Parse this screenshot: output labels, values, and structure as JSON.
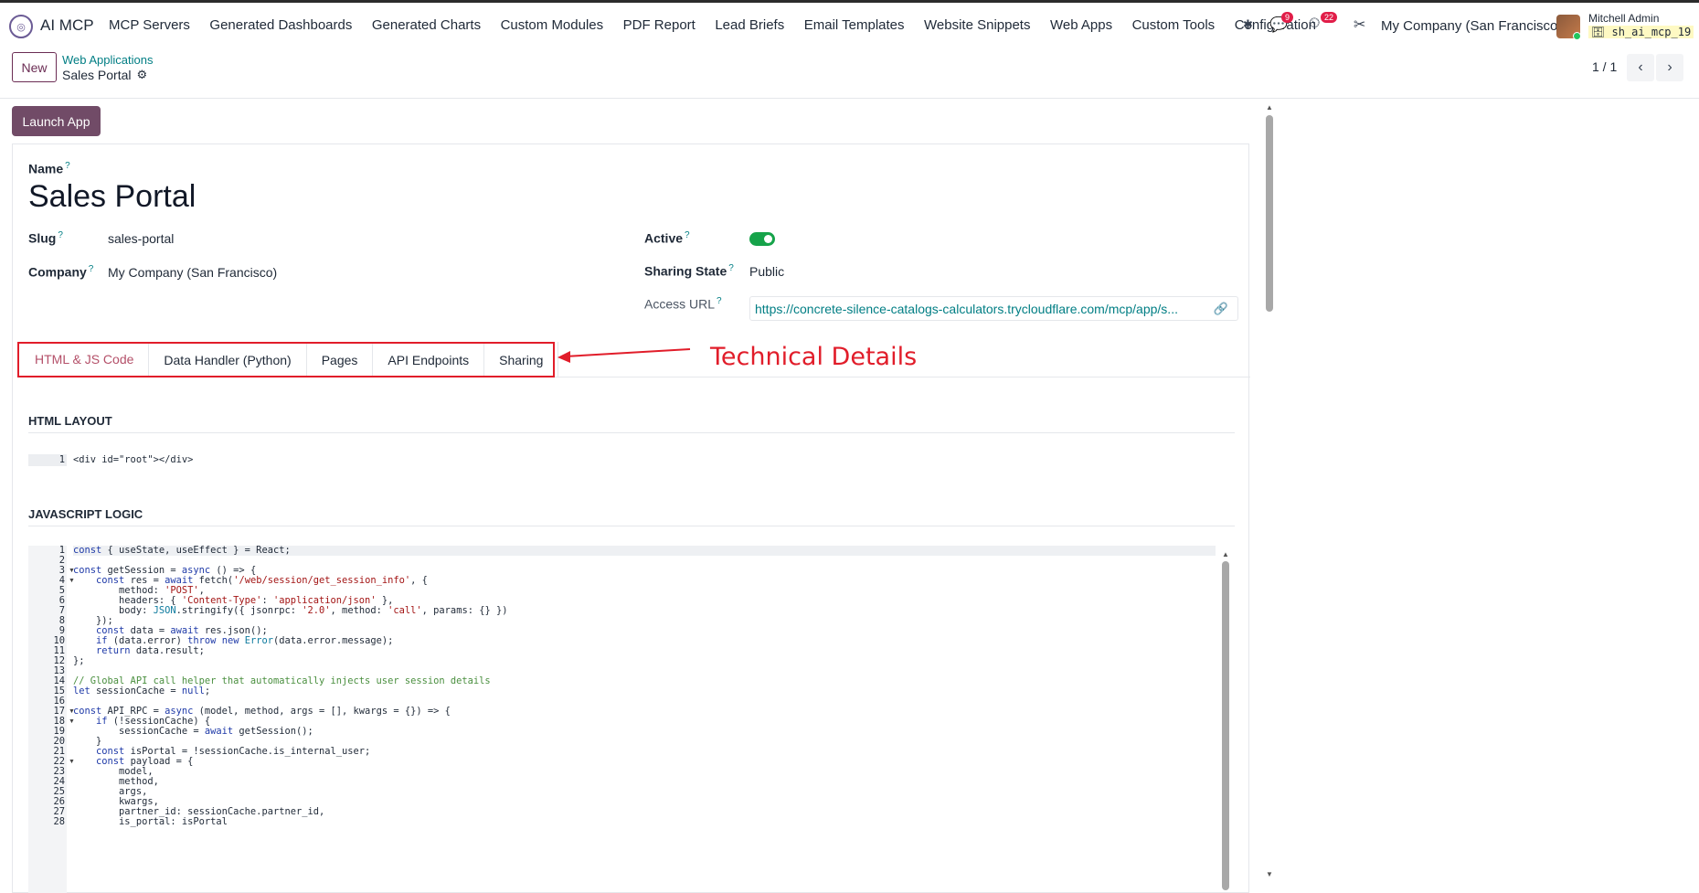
{
  "topbar": {
    "app_name": "AI MCP",
    "menu": [
      "MCP Servers",
      "Generated Dashboards",
      "Generated Charts",
      "Custom Modules",
      "PDF Report",
      "Lead Briefs",
      "Email Templates",
      "Website Snippets",
      "Web Apps",
      "Custom Tools",
      "Configuration"
    ],
    "messages_badge": "9",
    "activity_badge": "22",
    "company": "My Company (San Francisco)",
    "user_name": "Mitchell Admin",
    "database": "sh_ai_mcp_19"
  },
  "control": {
    "new_label": "New",
    "breadcrumb_parent": "Web Applications",
    "breadcrumb_current": "Sales Portal",
    "pager": "1 / 1"
  },
  "actions": {
    "launch_label": "Launch App"
  },
  "form": {
    "name_label": "Name",
    "name_value": "Sales Portal",
    "slug_label": "Slug",
    "slug_value": "sales-portal",
    "company_label": "Company",
    "company_value": "My Company (San Francisco)",
    "active_label": "Active",
    "active_value": true,
    "sharing_label": "Sharing State",
    "sharing_value": "Public",
    "url_label": "Access URL",
    "url_value": "https://concrete-silence-catalogs-calculators.trycloudflare.com/mcp/app/s..."
  },
  "tabs": [
    "HTML & JS Code",
    "Data Handler (Python)",
    "Pages",
    "API Endpoints",
    "Sharing"
  ],
  "active_tab": "HTML & JS Code",
  "annotation": "Technical Details",
  "html_section": {
    "title": "HTML LAYOUT",
    "code": "<div id=\"root\"></div>"
  },
  "js_section": {
    "title": "JAVASCRIPT LOGIC",
    "lines": [
      "const { useState, useEffect } = React;",
      "",
      "const getSession = async () => {",
      "    const res = await fetch('/web/session/get_session_info', {",
      "        method: 'POST',",
      "        headers: { 'Content-Type': 'application/json' },",
      "        body: JSON.stringify({ jsonrpc: '2.0', method: 'call', params: {} })",
      "    });",
      "    const data = await res.json();",
      "    if (data.error) throw new Error(data.error.message);",
      "    return data.result;",
      "};",
      "",
      "// Global API call helper that automatically injects user session details",
      "let sessionCache = null;",
      "",
      "const API_RPC = async (model, method, args = [], kwargs = {}) => {",
      "    if (!sessionCache) {",
      "        sessionCache = await getSession();",
      "    }",
      "    const isPortal = !sessionCache.is_internal_user;",
      "    const payload = {",
      "        model,",
      "        method,",
      "        args,",
      "        kwargs,",
      "        partner_id: sessionCache.partner_id,",
      "        is_portal: isPortal"
    ],
    "folds": [
      3,
      4,
      17,
      18,
      22
    ]
  }
}
